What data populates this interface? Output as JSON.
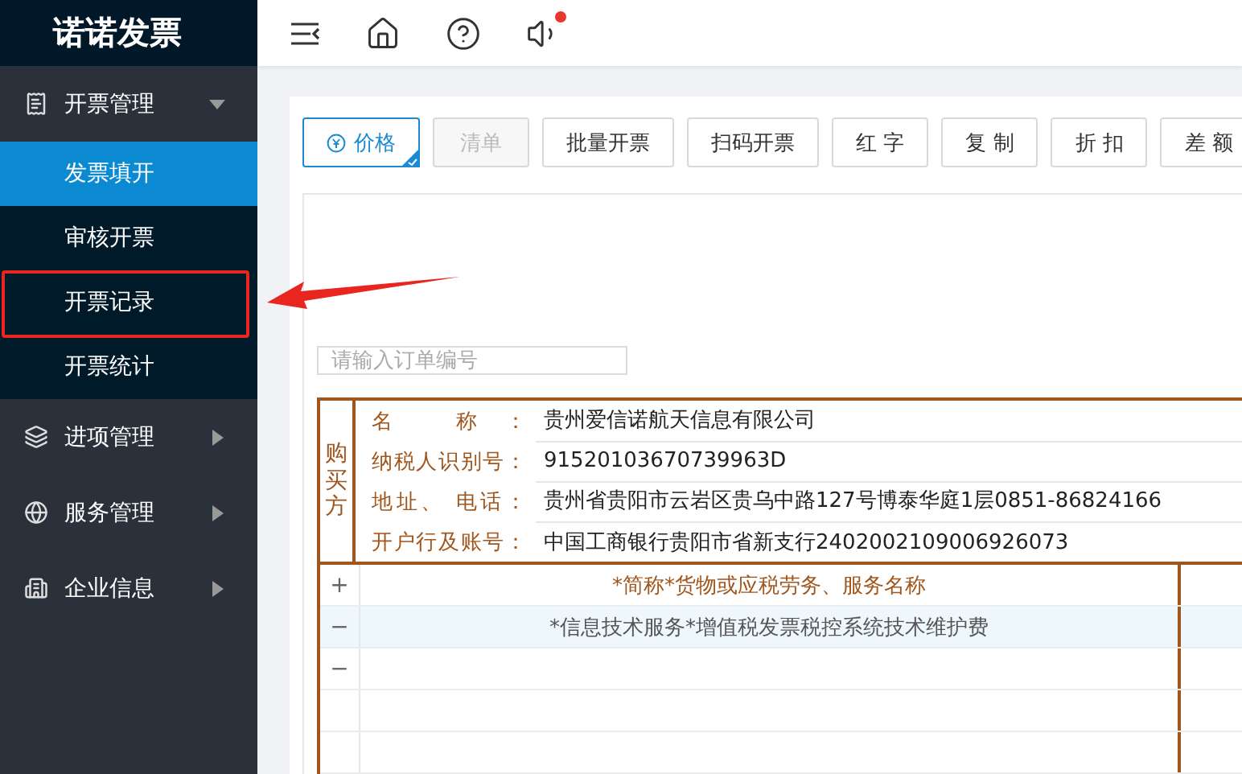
{
  "logo": "诺诺发票",
  "header": {
    "unread": true
  },
  "sidebar": {
    "groups": [
      {
        "label": "开票管理",
        "kind": "invoice",
        "expanded": true,
        "children": [
          {
            "label": "发票填开",
            "selected": true,
            "highlighted": false
          },
          {
            "label": "审核开票",
            "selected": false,
            "highlighted": false
          },
          {
            "label": "开票记录",
            "selected": false,
            "highlighted": true
          },
          {
            "label": "开票统计",
            "selected": false,
            "highlighted": false
          }
        ]
      },
      {
        "label": "进项管理",
        "kind": "layers",
        "expanded": false
      },
      {
        "label": "服务管理",
        "kind": "globe",
        "expanded": false
      },
      {
        "label": "企业信息",
        "kind": "building",
        "expanded": false
      }
    ]
  },
  "toolbar": [
    {
      "label": "价格",
      "kind": "price",
      "selected": true,
      "disabled": false
    },
    {
      "label": "清单",
      "kind": "plain",
      "selected": false,
      "disabled": true
    },
    {
      "label": "批量开票",
      "kind": "plain",
      "selected": false,
      "disabled": false
    },
    {
      "label": "扫码开票",
      "kind": "plain",
      "selected": false,
      "disabled": false
    },
    {
      "label": "红 字",
      "kind": "plain",
      "selected": false,
      "disabled": false
    },
    {
      "label": "复 制",
      "kind": "plain",
      "selected": false,
      "disabled": false
    },
    {
      "label": "折 扣",
      "kind": "plain",
      "selected": false,
      "disabled": false
    },
    {
      "label": "差 额",
      "kind": "plain",
      "selected": false,
      "disabled": false
    }
  ],
  "order_field": {
    "placeholder": "请输入订单编号"
  },
  "buyer": {
    "title": "购买方",
    "fields": [
      {
        "label": "名 称：",
        "value": "贵州爱信诺航天信息有限公司"
      },
      {
        "label": "纳税人识别号：",
        "value": "91520103670739963D"
      },
      {
        "label": "地址、 电话：",
        "value": "贵州省贵阳市云岩区贵乌中路127号博泰华庭1层0851-86824166"
      },
      {
        "label": "开户行及账号：",
        "value": "中国工商银行贵阳市省新支行2402002109006926073"
      }
    ]
  },
  "items": [
    {
      "kind": "header",
      "sign": "+",
      "name": "*简称*货物或应税劳务、服务名称",
      "selected": false
    },
    {
      "kind": "item",
      "sign": "−",
      "name": "*信息技术服务*增值税发票税控系统技术维护费",
      "selected": true
    },
    {
      "kind": "item",
      "sign": "−",
      "selected": false
    },
    {
      "kind": "blank",
      "selected": false
    },
    {
      "kind": "blank",
      "selected": false
    }
  ]
}
